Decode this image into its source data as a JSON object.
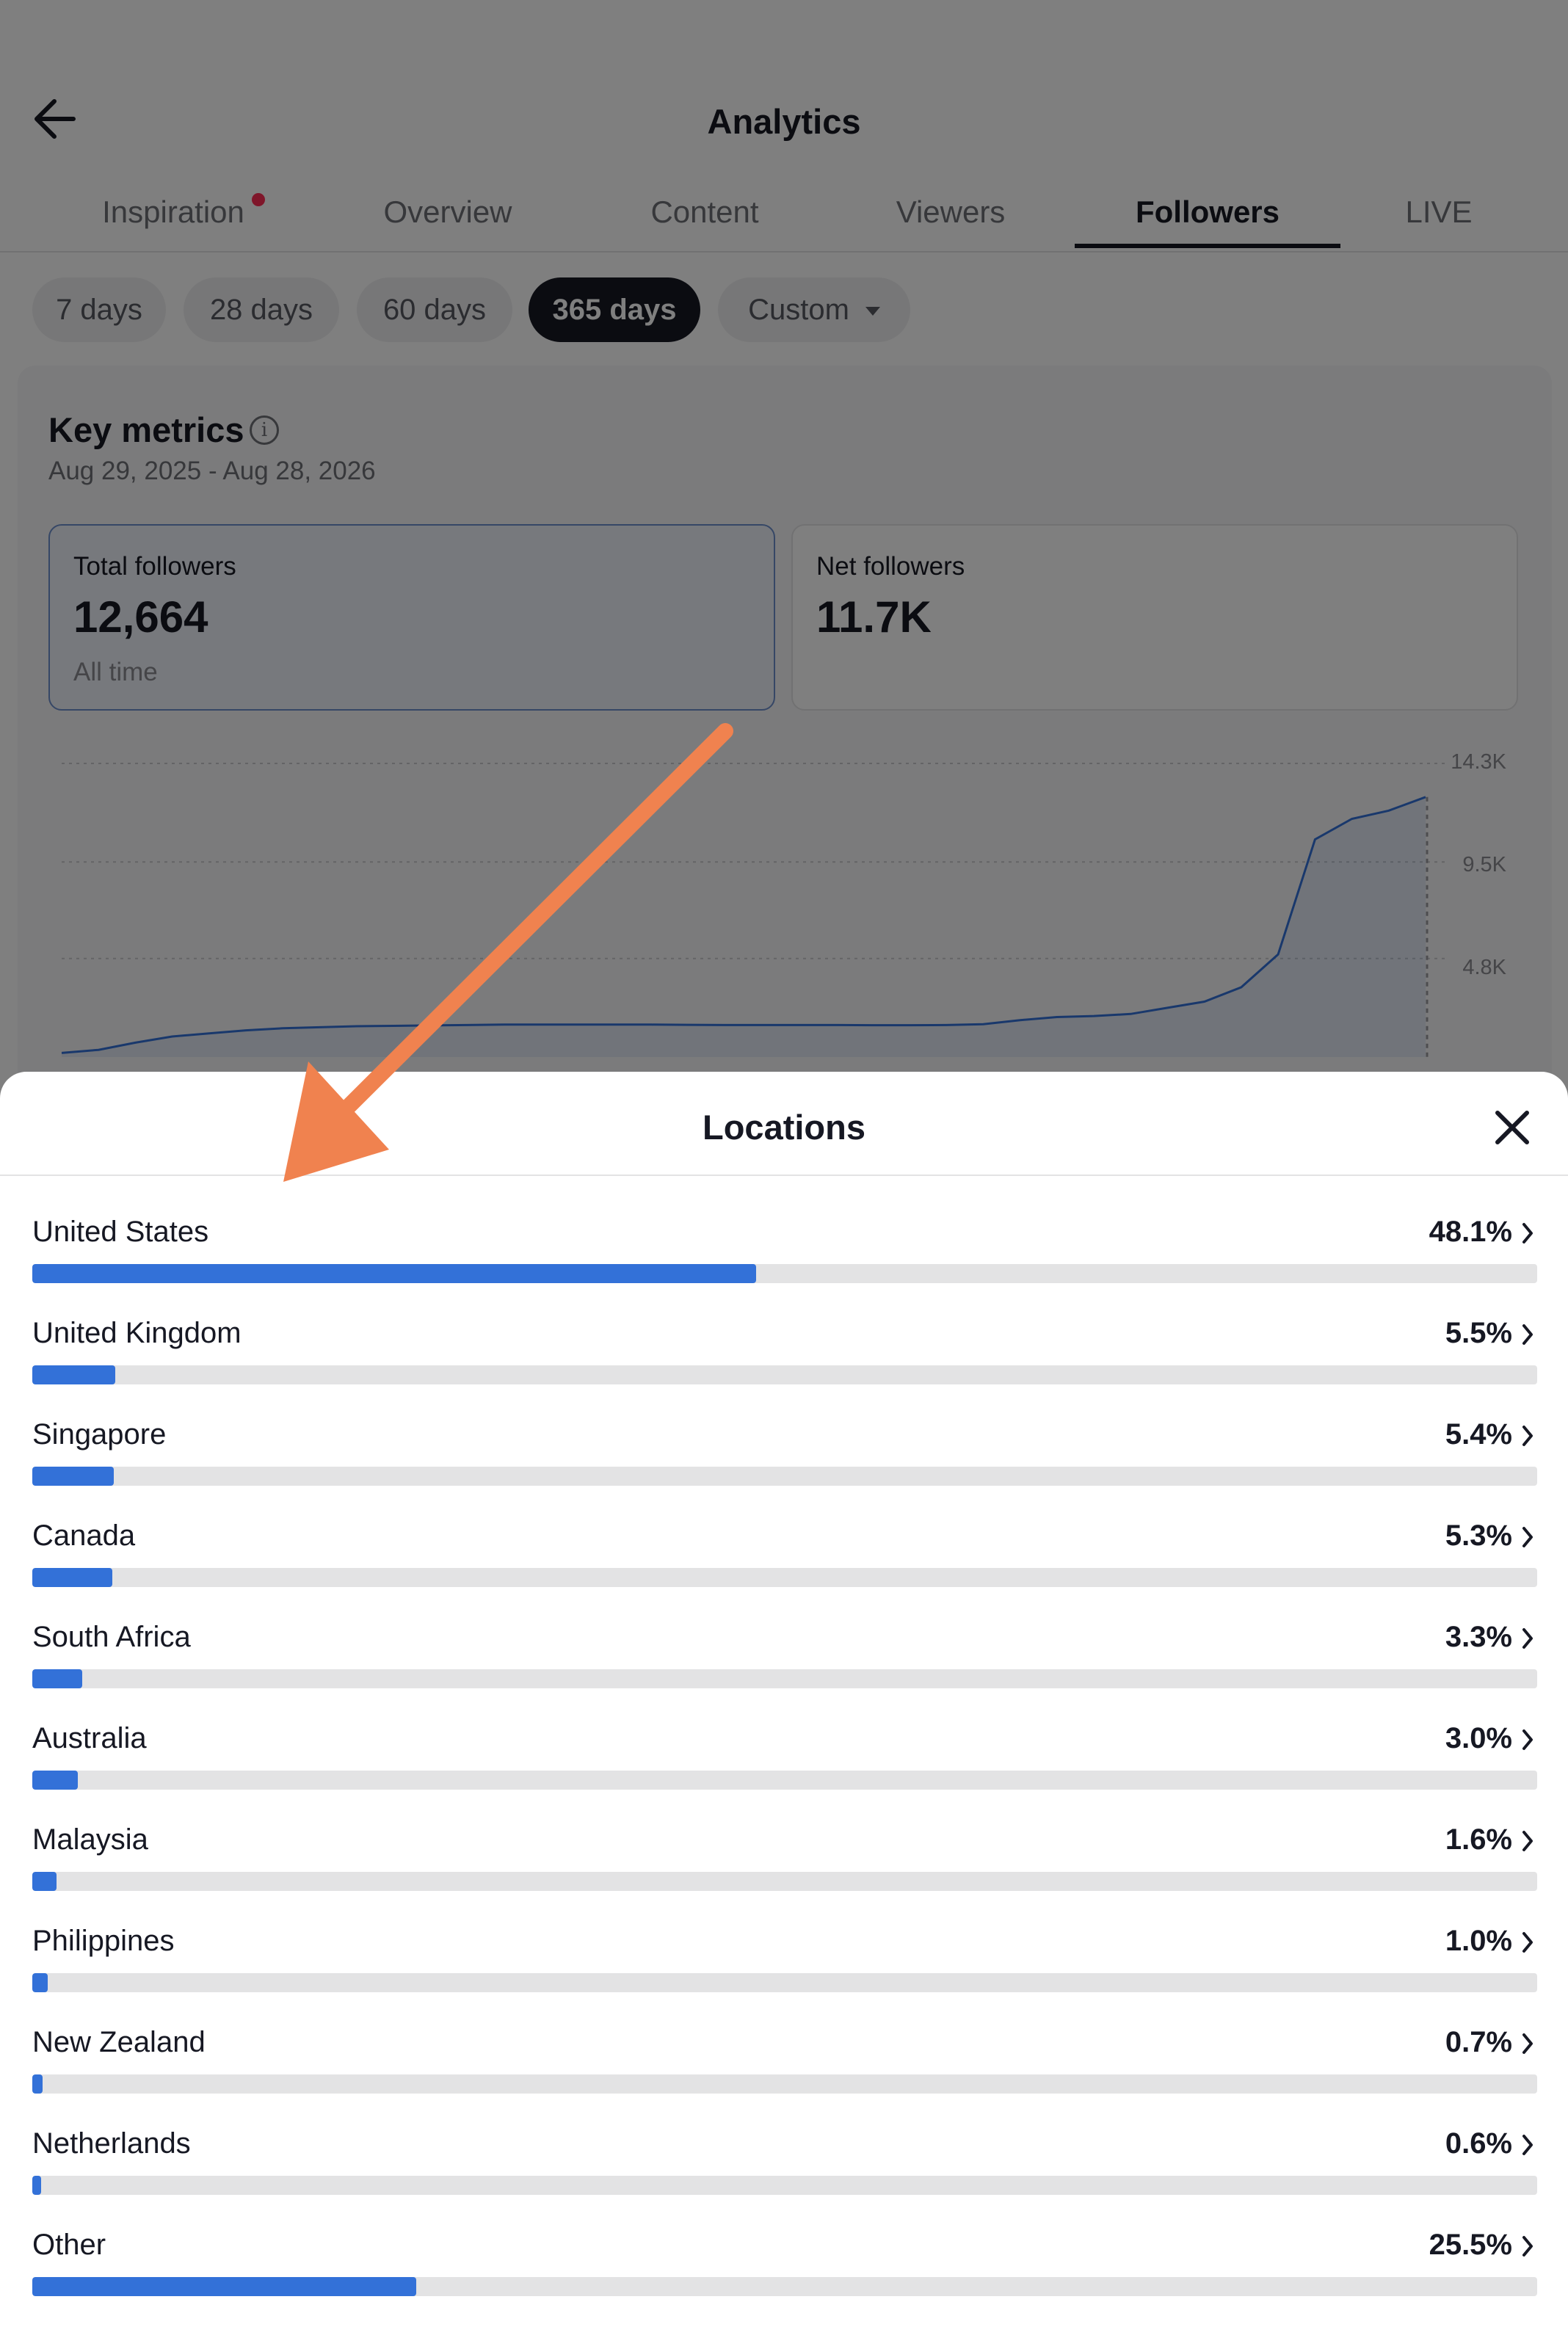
{
  "header": {
    "title": "Analytics",
    "back_icon": "back-arrow-icon"
  },
  "tabs": [
    {
      "label": "Inspiration",
      "has_dot": true,
      "active": false
    },
    {
      "label": "Overview",
      "active": false
    },
    {
      "label": "Content",
      "active": false
    },
    {
      "label": "Viewers",
      "active": false
    },
    {
      "label": "Followers",
      "active": true
    },
    {
      "label": "LIVE",
      "active": false
    }
  ],
  "range_chips": [
    {
      "label": "7 days",
      "active": false
    },
    {
      "label": "28 days",
      "active": false
    },
    {
      "label": "60 days",
      "active": false
    },
    {
      "label": "365 days",
      "active": true
    },
    {
      "label": "Custom",
      "active": false,
      "dropdown": true
    }
  ],
  "key_metrics": {
    "title": "Key metrics",
    "date_range": "Aug 29, 2025 - Aug 28, 2026",
    "metrics": [
      {
        "label": "Total followers",
        "value": "12,664",
        "sub": "All time",
        "selected": true
      },
      {
        "label": "Net followers",
        "value": "11.7K",
        "sub": "",
        "selected": false
      }
    ]
  },
  "chart_data": {
    "type": "line",
    "title": "",
    "xlabel": "",
    "ylabel": "",
    "y_ticks": [
      "14.3K",
      "9.5K",
      "4.8K"
    ],
    "ylim": [
      0,
      14300
    ],
    "grid": true,
    "series": [
      {
        "values": [
          200,
          350,
          700,
          1000,
          1150,
          1300,
          1400,
          1450,
          1500,
          1520,
          1540,
          1560,
          1580,
          1580,
          1580,
          1580,
          1580,
          1570,
          1560,
          1560,
          1560,
          1560,
          1550,
          1550,
          1560,
          1600,
          1800,
          1950,
          2000,
          2100,
          2400,
          2700,
          3400,
          5000,
          10600,
          11600,
          12000,
          12664
        ]
      }
    ],
    "line_color": "#3371d8"
  },
  "locations_sheet": {
    "title": "Locations",
    "close_icon": "close-icon",
    "items": [
      {
        "name": "United States",
        "percent_label": "48.1%",
        "percent": 48.1
      },
      {
        "name": "United Kingdom",
        "percent_label": "5.5%",
        "percent": 5.5
      },
      {
        "name": "Singapore",
        "percent_label": "5.4%",
        "percent": 5.4
      },
      {
        "name": "Canada",
        "percent_label": "5.3%",
        "percent": 5.3
      },
      {
        "name": "South Africa",
        "percent_label": "3.3%",
        "percent": 3.3
      },
      {
        "name": "Australia",
        "percent_label": "3.0%",
        "percent": 3.0
      },
      {
        "name": "Malaysia",
        "percent_label": "1.6%",
        "percent": 1.6
      },
      {
        "name": "Philippines",
        "percent_label": "1.0%",
        "percent": 1.0
      },
      {
        "name": "New Zealand",
        "percent_label": "0.7%",
        "percent": 0.7
      },
      {
        "name": "Netherlands",
        "percent_label": "0.6%",
        "percent": 0.6
      },
      {
        "name": "Other",
        "percent_label": "25.5%",
        "percent": 25.5
      }
    ]
  },
  "annotation": {
    "arrow_color": "#f0824f"
  }
}
